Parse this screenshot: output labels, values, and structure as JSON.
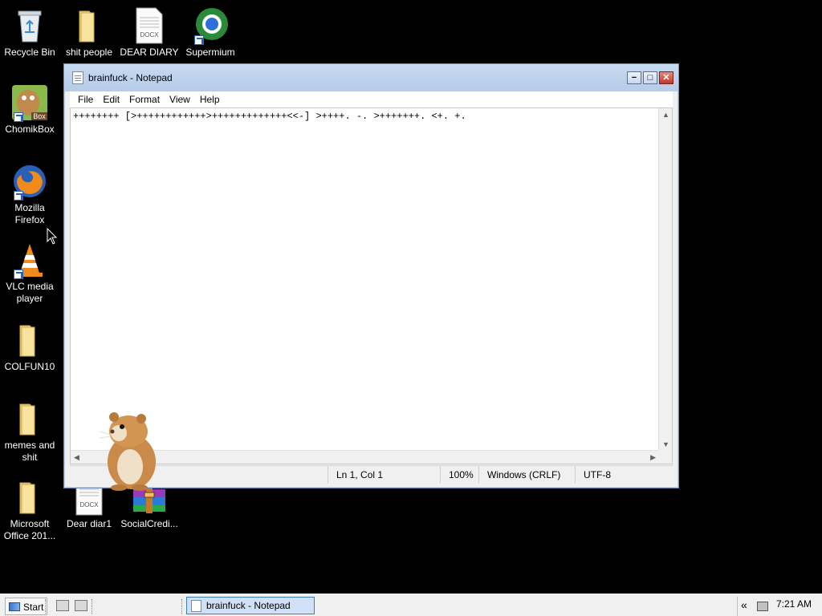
{
  "desktop": {
    "icons": [
      {
        "label": "Recycle Bin"
      },
      {
        "label": "shit people"
      },
      {
        "label": "DEAR DIARY",
        "badge": "DOCX"
      },
      {
        "label": "Supermium"
      },
      {
        "label": "ChomikBox",
        "badge": "Box"
      },
      {
        "label": "Mozilla Firefox"
      },
      {
        "label": "VLC media player"
      },
      {
        "label": "COLFUN10"
      },
      {
        "label": "memes and shit"
      },
      {
        "label": "Microsoft Office 201..."
      },
      {
        "label": "Dear diar1",
        "badge": "DOCX"
      },
      {
        "label": "SocialCredi..."
      }
    ]
  },
  "notepad": {
    "title": "brainfuck - Notepad",
    "menu": [
      "File",
      "Edit",
      "Format",
      "View",
      "Help"
    ],
    "content": "++++++++ [>++++++++++++>+++++++++++++<<-] >++++. -. >+++++++. <+. +.",
    "status": {
      "position": "Ln 1, Col 1",
      "zoom": "100%",
      "line_ending": "Windows (CRLF)",
      "encoding": "UTF-8"
    },
    "buttons": {
      "minimize": "−",
      "maximize": "□",
      "close": "✕"
    }
  },
  "taskbar": {
    "start_label": "Start",
    "active_task": "brainfuck - Notepad",
    "tray_chevron": "«",
    "clock": "7:21 AM"
  }
}
